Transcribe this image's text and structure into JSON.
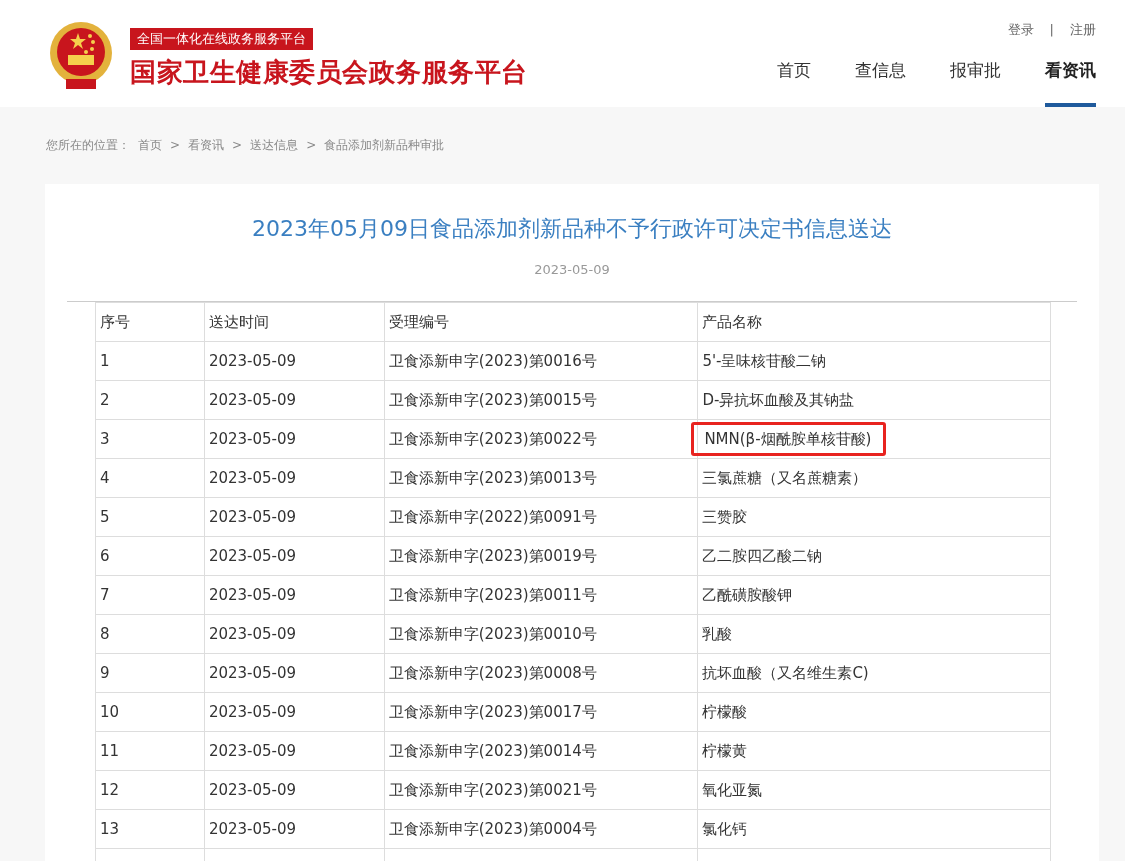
{
  "header": {
    "platform_tag": "全国一体化在线政务服务平台",
    "site_title": "国家卫生健康委员会政务服务平台",
    "user_links": [
      "登录",
      "注册"
    ],
    "user_separator": "|"
  },
  "nav": [
    {
      "label": "首页",
      "selected": false
    },
    {
      "label": "查信息",
      "selected": false
    },
    {
      "label": "报审批",
      "selected": false
    },
    {
      "label": "看资讯",
      "selected": true
    }
  ],
  "breadcrumb": {
    "prefix": "您所在的位置：",
    "items": [
      "首页",
      "看资讯",
      "送达信息",
      "食品添加剂新品种审批"
    ],
    "separator": ">"
  },
  "article": {
    "title": "2023年05月09日食品添加剂新品种不予行政许可决定书信息送达",
    "date": "2023-05-09"
  },
  "table": {
    "columns": [
      "序号",
      "送达时间",
      "受理编号",
      "产品名称"
    ],
    "rows": [
      {
        "cells": [
          "1",
          "2023-05-09",
          "卫食添新申字(2023)第0016号",
          "5'-呈味核苷酸二钠"
        ],
        "highlighted": false
      },
      {
        "cells": [
          "2",
          "2023-05-09",
          "卫食添新申字(2023)第0015号",
          "D-异抗坏血酸及其钠盐"
        ],
        "highlighted": false
      },
      {
        "cells": [
          "3",
          "2023-05-09",
          "卫食添新申字(2023)第0022号",
          "NMN(β-烟酰胺单核苷酸)"
        ],
        "highlighted": true
      },
      {
        "cells": [
          "4",
          "2023-05-09",
          "卫食添新申字(2023)第0013号",
          "三氯蔗糖（又名蔗糖素）"
        ],
        "highlighted": false
      },
      {
        "cells": [
          "5",
          "2023-05-09",
          "卫食添新申字(2022)第0091号",
          "三赞胶"
        ],
        "highlighted": false
      },
      {
        "cells": [
          "6",
          "2023-05-09",
          "卫食添新申字(2023)第0019号",
          "乙二胺四乙酸二钠"
        ],
        "highlighted": false
      },
      {
        "cells": [
          "7",
          "2023-05-09",
          "卫食添新申字(2023)第0011号",
          "乙酰磺胺酸钾"
        ],
        "highlighted": false
      },
      {
        "cells": [
          "8",
          "2023-05-09",
          "卫食添新申字(2023)第0010号",
          "乳酸"
        ],
        "highlighted": false
      },
      {
        "cells": [
          "9",
          "2023-05-09",
          "卫食添新申字(2023)第0008号",
          "抗坏血酸（又名维生素C)"
        ],
        "highlighted": false
      },
      {
        "cells": [
          "10",
          "2023-05-09",
          "卫食添新申字(2023)第0017号",
          "柠檬酸"
        ],
        "highlighted": false
      },
      {
        "cells": [
          "11",
          "2023-05-09",
          "卫食添新申字(2023)第0014号",
          "柠檬黄"
        ],
        "highlighted": false
      },
      {
        "cells": [
          "12",
          "2023-05-09",
          "卫食添新申字(2023)第0021号",
          "氧化亚氮"
        ],
        "highlighted": false
      },
      {
        "cells": [
          "13",
          "2023-05-09",
          "卫食添新申字(2023)第0004号",
          "氯化钙"
        ],
        "highlighted": false
      }
    ]
  }
}
